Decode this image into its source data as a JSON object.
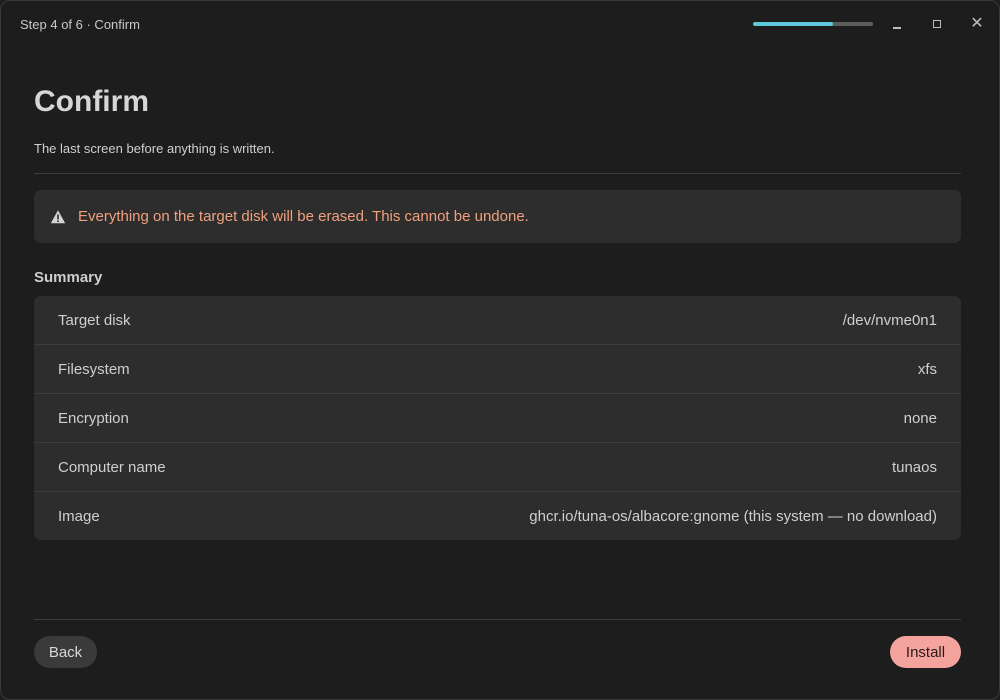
{
  "titlebar": {
    "step_label": "Step 4 of 6 · Confirm",
    "progress_percent": 66.7,
    "progress_color": "#5bc8dc"
  },
  "page": {
    "title": "Confirm",
    "subtitle": "The last screen before anything is written."
  },
  "warning": {
    "icon": "warning-triangle-icon",
    "text": "Everything on the target disk will be erased. This cannot be undone.",
    "color": "#f0a07e"
  },
  "summary": {
    "title": "Summary",
    "rows": [
      {
        "label": "Target disk",
        "value": "/dev/nvme0n1"
      },
      {
        "label": "Filesystem",
        "value": "xfs"
      },
      {
        "label": "Encryption",
        "value": "none"
      },
      {
        "label": "Computer name",
        "value": "tunaos"
      },
      {
        "label": "Image",
        "value": "ghcr.io/tuna-os/albacore:gnome (this system — no download)"
      }
    ]
  },
  "buttons": {
    "back_label": "Back",
    "install_label": "Install",
    "install_color": "#f5a39e"
  }
}
